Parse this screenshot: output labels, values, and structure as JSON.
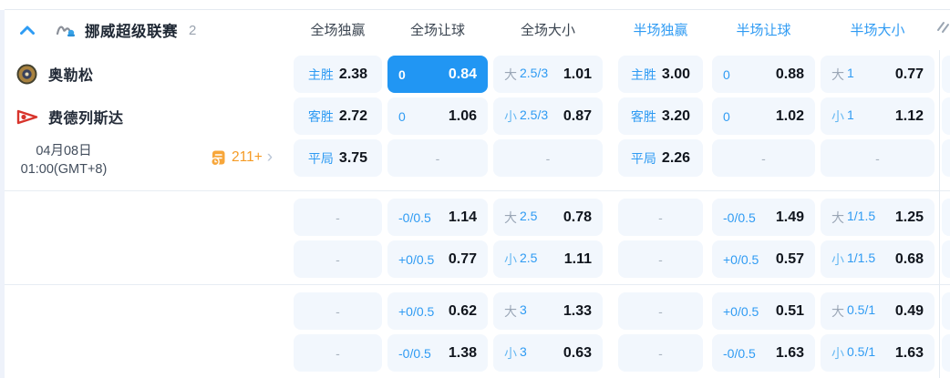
{
  "colors": {
    "highlight_cell": "#2196f3",
    "accent_blue": "#2f9bf3",
    "badge_orange": "#f59b25"
  },
  "league_header": {
    "league": "挪威超级联赛",
    "count": "2",
    "columns": [
      {
        "label": "全场独赢",
        "tone": "dark"
      },
      {
        "label": "全场让球",
        "tone": "dark"
      },
      {
        "label": "全场大小",
        "tone": "dark"
      },
      {
        "label": "半场独赢",
        "tone": "blue"
      },
      {
        "label": "半场让球",
        "tone": "blue"
      },
      {
        "label": "半场大小",
        "tone": "blue"
      }
    ]
  },
  "match": {
    "home": "奥勒松",
    "away": "费德列斯达",
    "date": "04月08日",
    "time": "01:00(GMT+8)",
    "more_markets": "211+",
    "more_chevron": "›"
  },
  "odds": {
    "dash_char": "-",
    "rows": [
      [
        {
          "t": "win",
          "label": "主胜",
          "value": "2.38"
        },
        {
          "t": "hcp",
          "label": "0",
          "value": "0.84",
          "hl": true
        },
        {
          "t": "ou",
          "prefix": "大",
          "tone": "gray",
          "line": "2.5/3",
          "value": "1.01"
        },
        {
          "t": "win",
          "label": "主胜",
          "value": "3.00"
        },
        {
          "t": "hcp",
          "label": "0",
          "value": "0.88"
        },
        {
          "t": "ou",
          "prefix": "大",
          "tone": "gray",
          "line": "1",
          "value": "0.77"
        }
      ],
      [
        {
          "t": "win",
          "label": "客胜",
          "value": "2.72"
        },
        {
          "t": "hcp",
          "label": "0",
          "value": "1.06"
        },
        {
          "t": "ou",
          "prefix": "小",
          "tone": "lb",
          "line": "2.5/3",
          "value": "0.87"
        },
        {
          "t": "win",
          "label": "客胜",
          "value": "3.20"
        },
        {
          "t": "hcp",
          "label": "0",
          "value": "1.02"
        },
        {
          "t": "ou",
          "prefix": "小",
          "tone": "lb",
          "line": "1",
          "value": "1.12"
        }
      ],
      [
        {
          "t": "win",
          "label": "平局",
          "value": "3.75"
        },
        {
          "t": "dash"
        },
        {
          "t": "dash"
        },
        {
          "t": "win",
          "label": "平局",
          "value": "2.26"
        },
        {
          "t": "dash"
        },
        {
          "t": "dash"
        }
      ],
      [
        {
          "t": "dash"
        },
        {
          "t": "hcp",
          "label": "-0/0.5",
          "value": "1.14"
        },
        {
          "t": "ou",
          "prefix": "大",
          "tone": "gray",
          "line": "2.5",
          "value": "0.78"
        },
        {
          "t": "dash"
        },
        {
          "t": "hcp",
          "label": "-0/0.5",
          "value": "1.49"
        },
        {
          "t": "ou",
          "prefix": "大",
          "tone": "gray",
          "line": "1/1.5",
          "value": "1.25"
        }
      ],
      [
        {
          "t": "dash"
        },
        {
          "t": "hcp",
          "label": "+0/0.5",
          "value": "0.77"
        },
        {
          "t": "ou",
          "prefix": "小",
          "tone": "lb",
          "line": "2.5",
          "value": "1.11"
        },
        {
          "t": "dash"
        },
        {
          "t": "hcp",
          "label": "+0/0.5",
          "value": "0.57"
        },
        {
          "t": "ou",
          "prefix": "小",
          "tone": "lb",
          "line": "1/1.5",
          "value": "0.68"
        }
      ],
      [
        {
          "t": "dash"
        },
        {
          "t": "hcp",
          "label": "+0/0.5",
          "value": "0.62"
        },
        {
          "t": "ou",
          "prefix": "大",
          "tone": "gray",
          "line": "3",
          "value": "1.33"
        },
        {
          "t": "dash"
        },
        {
          "t": "hcp",
          "label": "+0/0.5",
          "value": "0.51"
        },
        {
          "t": "ou",
          "prefix": "大",
          "tone": "gray",
          "line": "0.5/1",
          "value": "0.49"
        }
      ],
      [
        {
          "t": "dash"
        },
        {
          "t": "hcp",
          "label": "-0/0.5",
          "value": "1.38"
        },
        {
          "t": "ou",
          "prefix": "小",
          "tone": "lb",
          "line": "3",
          "value": "0.63"
        },
        {
          "t": "dash"
        },
        {
          "t": "hcp",
          "label": "-0/0.5",
          "value": "1.63"
        },
        {
          "t": "ou",
          "prefix": "小",
          "tone": "lb",
          "line": "0.5/1",
          "value": "1.63"
        }
      ]
    ]
  }
}
